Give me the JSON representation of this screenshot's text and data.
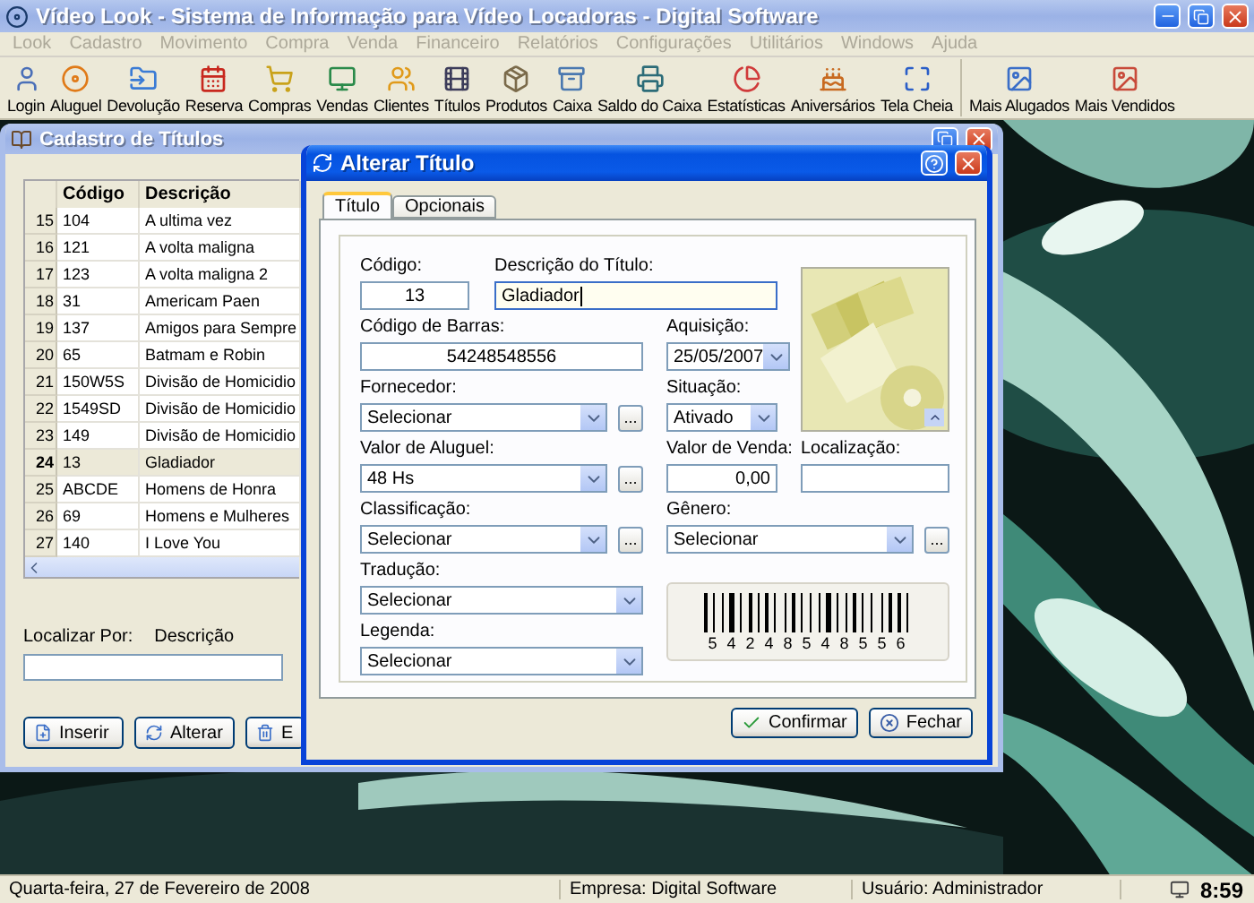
{
  "window": {
    "title": "Vídeo Look - Sistema de Informação para Vídeo Locadoras - Digital Software"
  },
  "menu": [
    {
      "label": "Look",
      "disabled": true
    },
    {
      "label": "Cadastro",
      "disabled": true
    },
    {
      "label": "Movimento",
      "disabled": true
    },
    {
      "label": "Compra",
      "disabled": true
    },
    {
      "label": "Venda",
      "disabled": true
    },
    {
      "label": "Financeiro",
      "disabled": true
    },
    {
      "label": "Relatórios",
      "disabled": true
    },
    {
      "label": "Configurações",
      "disabled": true
    },
    {
      "label": "Utilitários",
      "disabled": true
    },
    {
      "label": "Windows",
      "disabled": true
    },
    {
      "label": "Ajuda",
      "disabled": true
    }
  ],
  "toolbar": {
    "groups": [
      [
        {
          "label": "Login"
        },
        {
          "label": "Aluguel"
        },
        {
          "label": "Devolução"
        },
        {
          "label": "Reserva"
        },
        {
          "label": "Compras"
        },
        {
          "label": "Vendas"
        },
        {
          "label": "Clientes"
        },
        {
          "label": "Títulos"
        },
        {
          "label": "Produtos"
        },
        {
          "label": "Caixa"
        },
        {
          "label": "Saldo do Caixa"
        },
        {
          "label": "Estatísticas"
        },
        {
          "label": "Aniversários"
        },
        {
          "label": "Tela Cheia"
        }
      ],
      [
        {
          "label": "Mais Alugados"
        },
        {
          "label": "Mais Vendidos"
        }
      ]
    ]
  },
  "titles_window": {
    "title": "Cadastro de Títulos",
    "columns": [
      "Código",
      "Descrição"
    ],
    "rows": [
      {
        "number": "15",
        "code": "104",
        "description": "A ultima vez",
        "selected": false
      },
      {
        "number": "16",
        "code": "121",
        "description": "A volta maligna",
        "selected": false
      },
      {
        "number": "17",
        "code": "123",
        "description": "A volta maligna 2",
        "selected": false
      },
      {
        "number": "18",
        "code": "31",
        "description": "Americam Paen",
        "selected": false
      },
      {
        "number": "19",
        "code": "137",
        "description": "Amigos para Sempre",
        "selected": false
      },
      {
        "number": "20",
        "code": "65",
        "description": "Batmam e Robin",
        "selected": false
      },
      {
        "number": "21",
        "code": "150W5S",
        "description": "Divisão de Homicidio",
        "selected": false
      },
      {
        "number": "22",
        "code": "1549SD",
        "description": "Divisão de Homicidio",
        "selected": false
      },
      {
        "number": "23",
        "code": "149",
        "description": "Divisão de Homicidio",
        "selected": false
      },
      {
        "number": "24",
        "code": "13",
        "description": "Gladiador",
        "selected": true
      },
      {
        "number": "25",
        "code": "ABCDE",
        "description": "Homens de Honra",
        "selected": false
      },
      {
        "number": "26",
        "code": "69",
        "description": "Homens e Mulheres",
        "selected": false
      },
      {
        "number": "27",
        "code": "140",
        "description": "I Love You",
        "selected": false
      }
    ],
    "search": {
      "label": "Localizar Por:",
      "field": "Descrição"
    },
    "buttons": [
      "Inserir",
      "Alterar",
      "E"
    ]
  },
  "dialog": {
    "title": "Alterar Título",
    "tabs": [
      {
        "label": "Título",
        "selected": true
      },
      {
        "label": "Opcionais",
        "selected": false
      }
    ],
    "fields": [
      {
        "label": "Código:",
        "kind": "input",
        "value": "13",
        "focused": false
      },
      {
        "label": "Descrição do Título:",
        "kind": "input",
        "value": "Gladiador",
        "focused": true
      },
      {
        "label": "Código de Barras:",
        "kind": "input",
        "value": "54248548556",
        "focused": false
      },
      {
        "label": "Aquisição:",
        "kind": "select",
        "value": "25/05/2007",
        "focused": false
      },
      {
        "label": "Fornecedor:",
        "kind": "select",
        "value": "Selecionar",
        "lookup": "...",
        "focused": false
      },
      {
        "label": "Situação:",
        "kind": "select",
        "value": "Ativado",
        "focused": false
      },
      {
        "label": "Valor de Aluguel:",
        "kind": "select",
        "value": "48 Hs",
        "lookup": "...",
        "focused": false
      },
      {
        "label": "Valor de Venda:",
        "kind": "input",
        "value": "0,00",
        "focused": false
      },
      {
        "label": "Localização:",
        "kind": "input",
        "focused": false
      },
      {
        "label": "Classificação:",
        "kind": "select",
        "value": "Selecionar",
        "lookup": "...",
        "focused": false
      },
      {
        "label": "Gênero:",
        "kind": "select",
        "value": "Selecionar",
        "lookup": "...",
        "focused": false
      },
      {
        "label": "Tradução:",
        "kind": "select",
        "value": "Selecionar",
        "focused": false
      },
      {
        "label": "Legenda:",
        "kind": "select",
        "value": "Selecionar",
        "focused": false
      }
    ],
    "barcode": {
      "digits": "5 4 2 4 8 5 4 8 5 5 6"
    },
    "buttons": [
      "Confirmar",
      "Fechar"
    ]
  },
  "status_bar": {
    "date": "Quarta-feira, 27 de Fevereiro de 2008",
    "company": "Empresa: Digital Software",
    "user": "Usuário: Administrador",
    "clock": "8:59"
  }
}
